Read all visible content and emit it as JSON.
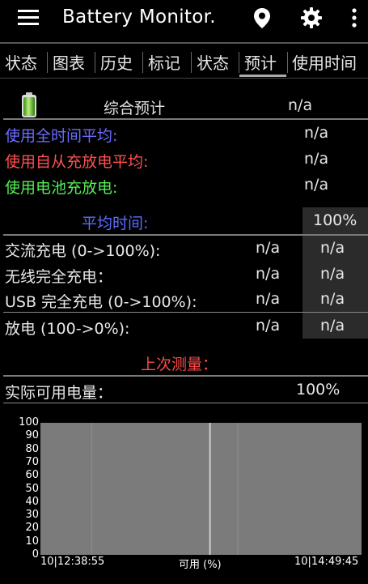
{
  "app_bar": {
    "title": "Battery Monitor.",
    "icons": [
      "menu-icon",
      "location-pin-icon",
      "gear-icon",
      "overflow-menu-icon"
    ]
  },
  "tabs": [
    {
      "label": "状态"
    },
    {
      "label": "图表"
    },
    {
      "label": "历史"
    },
    {
      "label": "标记"
    },
    {
      "label": "状态"
    },
    {
      "label": "预计",
      "selected": true
    },
    {
      "label": "使用时间"
    }
  ],
  "overall_estimate": {
    "heading": "综合预计",
    "value": "n/a",
    "icon": "battery-icon",
    "rows": [
      {
        "label": "使用全时间平均:",
        "value": "n/a",
        "color": "#6b6bff"
      },
      {
        "label": "使用自从充放电平均:",
        "value": "n/a",
        "color": "#ff5050"
      },
      {
        "label": "使用电池充放电:",
        "value": "n/a",
        "color": "#55ee55"
      }
    ]
  },
  "average_time": {
    "heading": "平均时间:",
    "heading_color": "#5c6cff",
    "column_header": "100%",
    "rows": [
      {
        "label": "交流充电 (0->100%):",
        "value1": "n/a",
        "value2": "n/a"
      },
      {
        "label": "无线完全充电：",
        "value1": "n/a",
        "value2": "n/a"
      },
      {
        "label": "USB 完全充电 (0->100%):",
        "value1": "n/a",
        "value2": "n/a"
      },
      {
        "label": "放电 (100->0%):",
        "value1": "n/a",
        "value2": "n/a"
      }
    ]
  },
  "last_measure": {
    "heading": "上次测量：",
    "heading_color": "#ff4a4a",
    "label": "实际可用电量：",
    "value": "100%"
  },
  "chart_data": {
    "type": "line",
    "title": "",
    "xlabel": "可用 (%)",
    "ylabel": "",
    "y_ticks": [
      "100",
      "90",
      "80",
      "70",
      "60",
      "50",
      "40",
      "30",
      "20",
      "10",
      "0"
    ],
    "ylim": [
      0,
      100
    ],
    "x_start_label": "10|12:38:55",
    "x_end_label": "10|14:49:45",
    "series": [],
    "grid": true,
    "colors": {
      "plot_bg": "#7b7b7b",
      "grid": "#8e8e8e",
      "marker_line": "#cfcfcf"
    }
  }
}
